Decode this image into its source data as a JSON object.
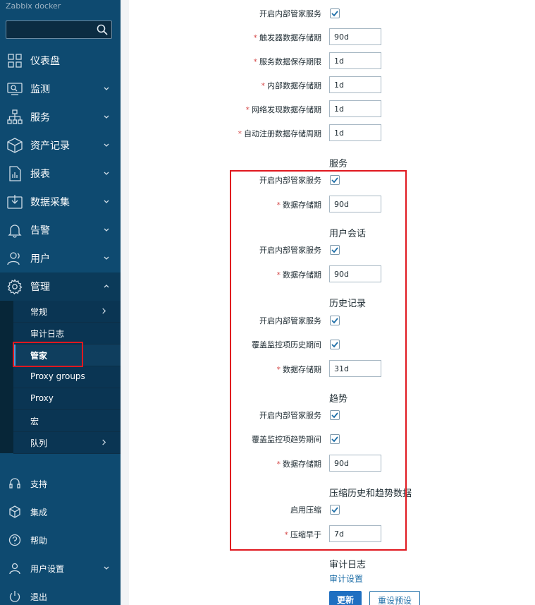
{
  "sidebar": {
    "brand": "Zabbix docker",
    "search_value": "",
    "menu": [
      {
        "label": "仪表盘",
        "icon": "dashboard-icon"
      },
      {
        "label": "监测",
        "icon": "monitoring-icon"
      },
      {
        "label": "服务",
        "icon": "services-icon"
      },
      {
        "label": "资产记录",
        "icon": "inventory-icon"
      },
      {
        "label": "报表",
        "icon": "reports-icon"
      },
      {
        "label": "数据采集",
        "icon": "data-collection-icon"
      },
      {
        "label": "告警",
        "icon": "alerts-icon"
      },
      {
        "label": "用户",
        "icon": "users-icon"
      },
      {
        "label": "管理",
        "icon": "administration-icon"
      }
    ],
    "submenu": [
      "常规",
      "审计日志",
      "管家",
      "Proxy groups",
      "Proxy",
      "宏",
      "队列"
    ],
    "bottom": [
      {
        "label": "支持",
        "icon": "support-icon"
      },
      {
        "label": "集成",
        "icon": "integrations-icon"
      },
      {
        "label": "帮助",
        "icon": "help-icon"
      },
      {
        "label": "用户设置",
        "icon": "user-settings-icon"
      },
      {
        "label": "退出",
        "icon": "sign-out-icon"
      }
    ]
  },
  "form": {
    "events": {
      "enable_label": "开启内部管家服务",
      "trigger_label": "触发器数据存储期",
      "trigger_value": "90d",
      "service_label": "服务数据保存期限",
      "service_value": "1d",
      "internal_label": "内部数据存储期",
      "internal_value": "1d",
      "network_label": "网络发现数据存储期",
      "network_value": "1d",
      "autoreg_label": "自动注册数据存储周期",
      "autoreg_value": "1d"
    },
    "services": {
      "heading": "服务",
      "enable_label": "开启内部管家服务",
      "storage_label": "数据存储期",
      "storage_value": "90d"
    },
    "sessions": {
      "heading": "用户会话",
      "enable_label": "开启内部管家服务",
      "storage_label": "数据存储期",
      "storage_value": "90d"
    },
    "history": {
      "heading": "历史记录",
      "enable_label": "开启内部管家服务",
      "override_label": "覆盖监控项历史期间",
      "storage_label": "数据存储期",
      "storage_value": "31d"
    },
    "trends": {
      "heading": "趋势",
      "enable_label": "开启内部管家服务",
      "override_label": "覆盖监控项趋势期间",
      "storage_label": "数据存储期",
      "storage_value": "90d"
    },
    "compression": {
      "heading": "压缩历史和趋势数据",
      "enable_label": "启用压缩",
      "older_label": "压缩早于",
      "older_value": "7d"
    },
    "audit": {
      "heading": "审计日志",
      "link": "审计设置"
    },
    "update_button": "更新",
    "reset_button": "重设预设"
  }
}
